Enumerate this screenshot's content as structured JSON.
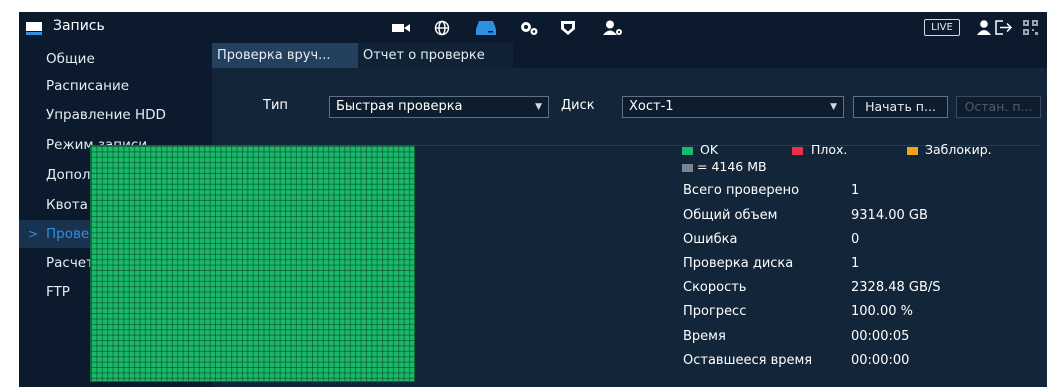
{
  "header": {
    "title": "Запись",
    "live_label": "LIVE",
    "icons": [
      "record-icon",
      "camera-icon",
      "network-icon",
      "storage-icon",
      "system-icon",
      "security-icon",
      "account-icon",
      "user-icon",
      "logout-icon",
      "qr-icon"
    ]
  },
  "sidebar": {
    "items": [
      {
        "label": "Общие"
      },
      {
        "label": "Расписание"
      },
      {
        "label": "Управление HDD"
      },
      {
        "label": "Режим записи"
      },
      {
        "label": "Дополнительно"
      },
      {
        "label": "Квота диска"
      },
      {
        "label": "Проверка диска",
        "active": true
      },
      {
        "label": "Расчет архива"
      },
      {
        "label": "FTP"
      }
    ]
  },
  "tabs": [
    {
      "label": "Проверка вруч...",
      "active": true
    },
    {
      "label": "Отчет о проверке",
      "active": false
    }
  ],
  "form": {
    "type_label": "Тип",
    "type_value": "Быстрая проверка",
    "disk_label": "Диск",
    "disk_value": "Хост-1",
    "start_button": "Начать п...",
    "stop_button": "Остан. п..."
  },
  "legend": {
    "ok": "OK",
    "bad": "Плох.",
    "blocked": "Заблокир.",
    "unit": "= 4146 MB",
    "colors": {
      "ok": "#19b86a",
      "bad": "#e8304a",
      "blocked": "#f0a21c",
      "unit": "#7a8593"
    }
  },
  "stats": [
    {
      "key": "Всего проверено",
      "value": "1"
    },
    {
      "key": "Общий объем",
      "value": "9314.00 GB"
    },
    {
      "key": "Ошибка",
      "value": "0"
    },
    {
      "key": "Проверка диска",
      "value": "1"
    },
    {
      "key": "Скорость",
      "value": "2328.48 GB/S"
    },
    {
      "key": "Прогресс",
      "value": "100.00 %"
    },
    {
      "key": "Время",
      "value": "00:00:05"
    },
    {
      "key": "Оставшееся время",
      "value": "00:00:00"
    }
  ],
  "colors": {
    "accent": "#2f8fe0",
    "background": "#0b1a2c",
    "panel": "#132538"
  }
}
